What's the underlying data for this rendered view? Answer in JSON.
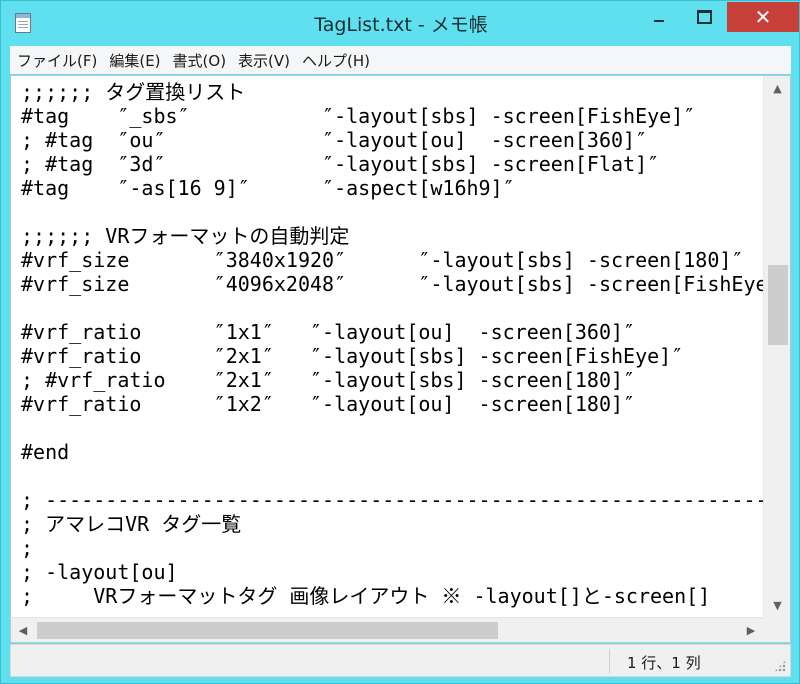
{
  "window": {
    "title": "TagList.txt - メモ帳",
    "close_glyph": "✕"
  },
  "menu": {
    "items": [
      {
        "label": "ファイル(F)"
      },
      {
        "label": "編集(E)"
      },
      {
        "label": "書式(O)"
      },
      {
        "label": "表示(V)"
      },
      {
        "label": "ヘルプ(H)"
      }
    ]
  },
  "editor": {
    "lines": [
      ";;;;;; タグ置換リスト",
      "#tag    ″_sbs″           ″-layout[sbs] -screen[FishEye]″",
      "; #tag  ″ou″             ″-layout[ou]  -screen[360]″",
      "; #tag  ″3d″             ″-layout[sbs] -screen[Flat]″",
      "#tag    ″-as[16 9]″      ″-aspect[w16h9]″",
      "",
      ";;;;;; VRフォーマットの自動判定",
      "#vrf_size       ″3840x1920″      ″-layout[sbs] -screen[180]″",
      "#vrf_size       ″4096x2048″      ″-layout[sbs] -screen[FishEye]",
      "",
      "#vrf_ratio      ″1x1″   ″-layout[ou]  -screen[360]″",
      "#vrf_ratio      ″2x1″   ″-layout[sbs] -screen[FishEye]″",
      "; #vrf_ratio    ″2x1″   ″-layout[sbs] -screen[180]″",
      "#vrf_ratio      ″1x2″   ″-layout[ou]  -screen[180]″",
      "",
      "#end",
      "",
      "; ------------------------------------------------------------------------",
      "; アマレコVR タグ一覧",
      ";",
      "; -layout[ou]",
      ";     VRフォーマットタグ 画像レイアウト ※ -layout[]と-screen[]"
    ]
  },
  "scrollbars": {
    "vertical": {
      "up_glyph": "▲",
      "down_glyph": "▼"
    },
    "horizontal": {
      "left_glyph": "◀",
      "right_glyph": "▶"
    }
  },
  "status": {
    "position": "1 行、1 列"
  }
}
